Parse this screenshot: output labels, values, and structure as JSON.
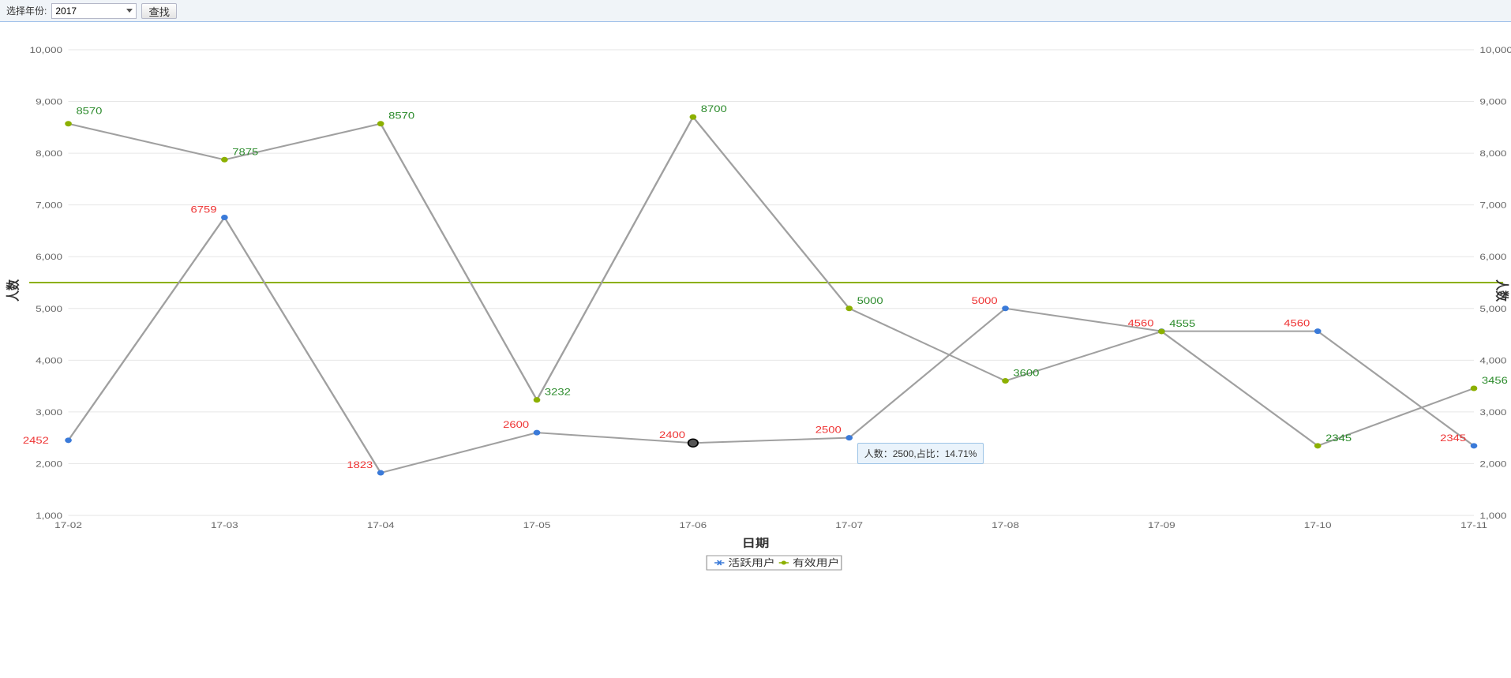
{
  "toolbar": {
    "year_label": "选择年份:",
    "year_value": "2017",
    "search_label": "查找"
  },
  "tooltip": {
    "text": "人数：2500,占比：14.71%"
  },
  "chart_data": {
    "type": "line",
    "x_categories": [
      "17-02",
      "17-03",
      "17-04",
      "17-05",
      "17-06",
      "17-07",
      "17-08",
      "17-09",
      "17-10",
      "17-11"
    ],
    "series": [
      {
        "name": "活跃用户",
        "color": "#3a7ad9",
        "label_color": "red",
        "values": [
          2452,
          6759,
          1823,
          2600,
          2400,
          2500,
          5000,
          4560,
          4560,
          2345
        ],
        "labels": [
          "2452",
          "6759",
          "1823",
          "2600",
          "2400",
          "2500",
          "5000",
          "4560",
          "4560",
          "2345"
        ]
      },
      {
        "name": "有效用户",
        "color": "#8cb000",
        "label_color": "green",
        "values": [
          8570,
          7875,
          8570,
          3232,
          8700,
          5000,
          3600,
          4555,
          2345,
          3456
        ],
        "labels": [
          "8570",
          "7875",
          "8570",
          "3232",
          "8700",
          "5000",
          "3600",
          "4555",
          "2345",
          "3456"
        ]
      }
    ],
    "y_ticks": [
      1000,
      2000,
      3000,
      4000,
      5000,
      6000,
      7000,
      8000,
      9000,
      10000
    ],
    "y_tick_labels": [
      "1,000",
      "2,000",
      "3,000",
      "4,000",
      "5,000",
      "6,000",
      "7,000",
      "8,000",
      "9,000",
      "10,000"
    ],
    "ylim": [
      1000,
      10000
    ],
    "reference_line": 5500,
    "xlabel": "日期",
    "ylabel_left": "人数",
    "ylabel_right": "人数",
    "highlight_index": 4,
    "tooltip_index": 5
  },
  "legend": {
    "items": [
      {
        "name": "活跃用户",
        "marker": "blue-x"
      },
      {
        "name": "有效用户",
        "marker": "green-dot"
      }
    ]
  }
}
